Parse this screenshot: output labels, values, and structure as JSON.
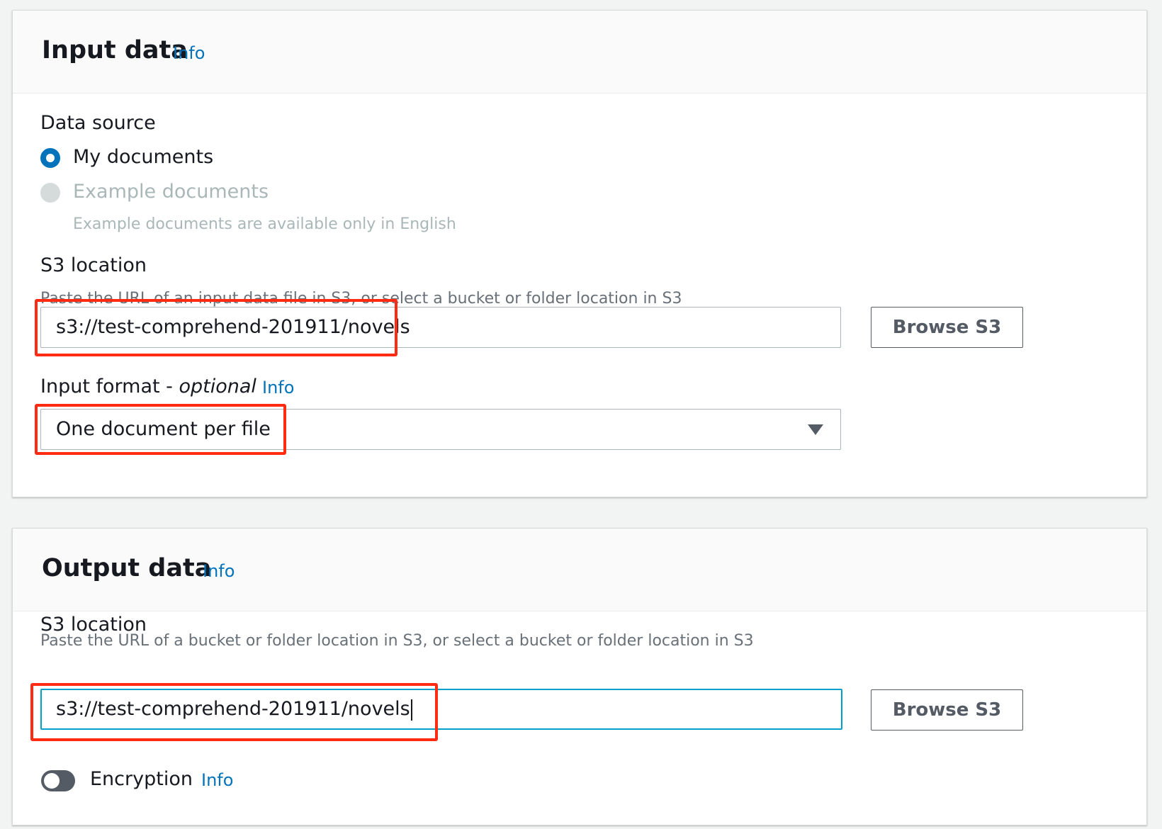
{
  "input_panel": {
    "title": "Input data",
    "info": "Info",
    "data_source": {
      "label": "Data source",
      "options": [
        {
          "label": "My documents",
          "selected": true,
          "disabled": false
        },
        {
          "label": "Example documents",
          "description": "Example documents are available only in English",
          "selected": false,
          "disabled": true
        }
      ]
    },
    "s3_location": {
      "label": "S3 location",
      "description": "Paste the URL of an input data file in S3, or select a bucket or folder location in S3",
      "value": "s3://test-comprehend-201911/novels",
      "browse_label": "Browse S3"
    },
    "input_format": {
      "label": "Input format - ",
      "optional": "optional",
      "info": "Info",
      "selected": "One document per file"
    }
  },
  "output_panel": {
    "title": "Output data",
    "info": "Info",
    "s3_location": {
      "label": "S3 location",
      "description": "Paste the URL of a bucket or folder location in S3, or select a bucket or folder location in S3",
      "value": "s3://test-comprehend-201911/novels",
      "browse_label": "Browse S3"
    },
    "encryption": {
      "label": "Encryption",
      "info": "Info",
      "enabled": false
    }
  },
  "colors": {
    "link": "#0073bb",
    "highlight": "#ff2a12",
    "focus_border": "#00a1c9"
  }
}
